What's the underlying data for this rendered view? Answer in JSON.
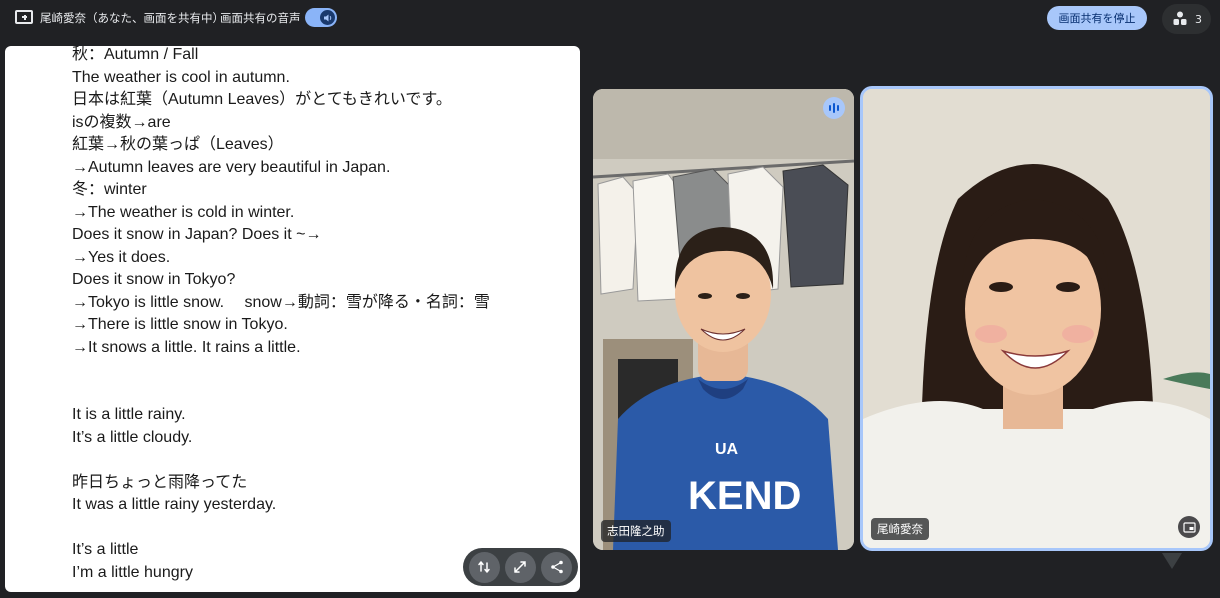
{
  "topbar": {
    "presenter_label": "尾崎愛奈（あなた、画面を共有中）",
    "audio_label": "画面共有の音声",
    "audio_toggle_on": true,
    "stop_sharing_label": "画面共有を停止",
    "participant_count": "3"
  },
  "document": {
    "lines": [
      "秋：Autumn / Fall",
      "The weather is cool in autumn.",
      "日本は紅葉（Autumn Leaves）がとてもきれいです。",
      "isの複数→are",
      "紅葉→秋の葉っぱ（Leaves）",
      "→Autumn leaves are very beautiful in Japan.",
      "冬：winter",
      "→The weather is cold in winter.",
      "Does it snow in Japan? Does it ~→",
      "→Yes it does.",
      "Does it snow in Tokyo?",
      "→Tokyo is little snow.　 snow→動詞：雪が降る・名詞：雪",
      "→There is little snow in Tokyo.",
      "→It snows a little. It rains a little.",
      "",
      "",
      "It is a little rainy.",
      "It’s a little cloudy.",
      "",
      "昨日ちょっと雨降ってた",
      "It was a little rainy yesterday.",
      "",
      "It’s a little",
      "I’m a little hungry"
    ]
  },
  "participants": [
    {
      "name": "志田隆之助",
      "speaking": true
    },
    {
      "name": "尾崎愛奈",
      "pinned": true
    }
  ],
  "colors": {
    "background": "#202124",
    "accent": "#a8c7fa",
    "accent_text": "#062e6f"
  }
}
